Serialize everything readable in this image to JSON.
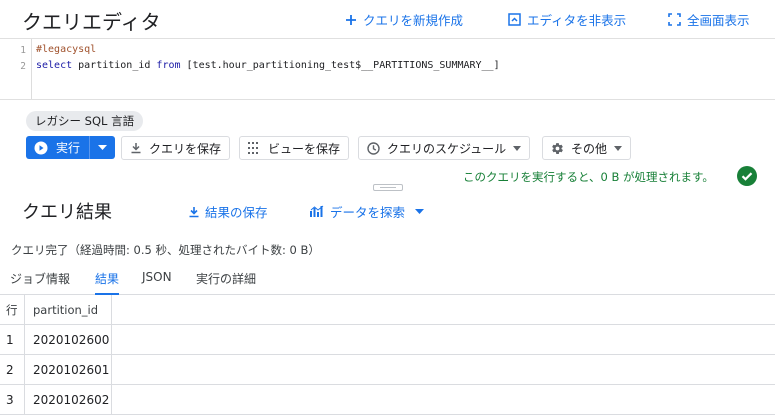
{
  "header": {
    "title": "クエリエディタ",
    "new_query": "クエリを新規作成",
    "hide_editor": "エディタを非表示",
    "fullscreen": "全画面表示"
  },
  "editor": {
    "line_numbers": [
      "1",
      "2"
    ],
    "line1": "#legacysql",
    "line2_kw1": "select",
    "line2_mid": " partition_id ",
    "line2_kw2": "from",
    "line2_rest": " [test.hour_partitioning_test$__PARTITIONS_SUMMARY__]"
  },
  "dialect_chip": "レガシー SQL 言語",
  "toolbar": {
    "run": "実行",
    "save_query": "クエリを保存",
    "save_view": "ビューを保存",
    "schedule": "クエリのスケジュール",
    "more": "その他"
  },
  "status_message": "このクエリを実行すると、0 B が処理されます。",
  "results": {
    "title": "クエリ結果",
    "save_results": "結果の保存",
    "explore_data": "データを探索",
    "summary": "クエリ完了（経過時間: 0.5 秒、処理されたバイト数: 0 B）",
    "tabs": [
      "ジョブ情報",
      "結果",
      "JSON",
      "実行の詳細"
    ],
    "active_tab": "結果",
    "columns": [
      "行",
      "partition_id"
    ],
    "rows": [
      [
        "1",
        "2020102600"
      ],
      [
        "2",
        "2020102601"
      ],
      [
        "3",
        "2020102602"
      ]
    ]
  },
  "colors": {
    "accent": "#1a73e8",
    "success": "#188038"
  }
}
